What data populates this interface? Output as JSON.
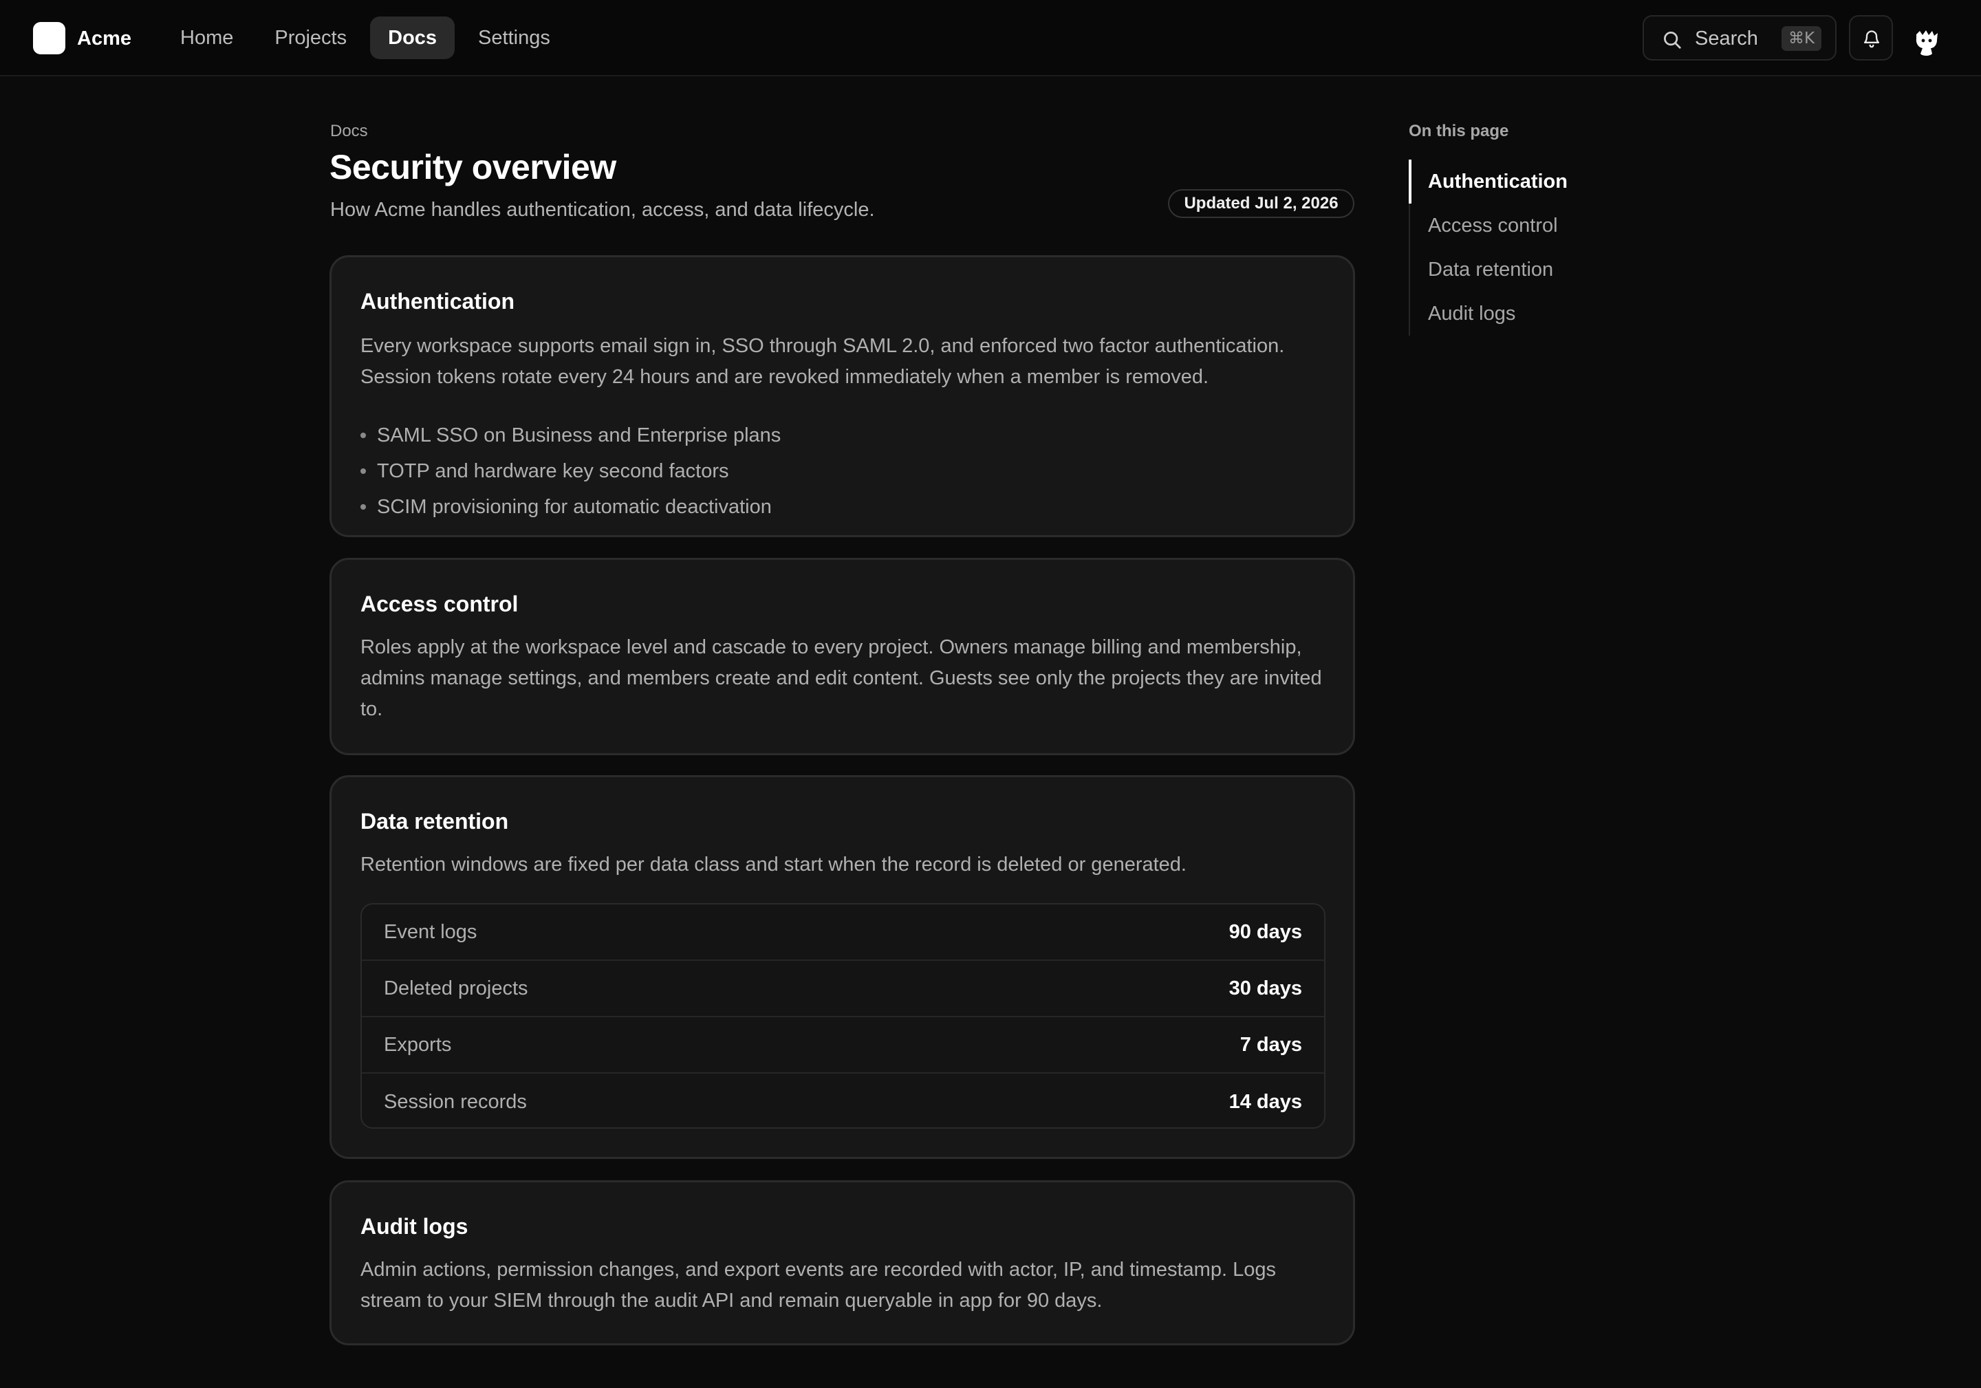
{
  "brand": {
    "name": "Acme"
  },
  "nav": {
    "items": [
      {
        "label": "Home",
        "active": false
      },
      {
        "label": "Projects",
        "active": false
      },
      {
        "label": "Docs",
        "active": true
      },
      {
        "label": "Settings",
        "active": false
      }
    ]
  },
  "search": {
    "label": "Search",
    "shortcut": "⌘K",
    "icon": "search-icon"
  },
  "notifications": {
    "icon": "bell-icon"
  },
  "page": {
    "breadcrumb": "Docs",
    "title": "Security overview",
    "subtitle": "How Acme handles authentication, access, and data lifecycle.",
    "updated": "Updated Jul 2, 2026"
  },
  "sections": {
    "authentication": {
      "title": "Authentication",
      "body": "Every workspace supports email sign in, SSO through SAML 2.0, and enforced two factor authentication. Session tokens rotate every 24 hours and are revoked immediately when a member is removed.",
      "bullets": [
        "SAML SSO on Business and Enterprise plans",
        "TOTP and hardware key second factors",
        "SCIM provisioning for automatic deactivation"
      ]
    },
    "access_control": {
      "title": "Access control",
      "body": "Roles apply at the workspace level and cascade to every project. Owners manage billing and membership, admins manage settings, and members create and edit content. Guests see only the projects they are invited to."
    },
    "data_retention": {
      "title": "Data retention",
      "body": "Retention windows are fixed per data class and start when the record is deleted or generated.",
      "rows": [
        {
          "label": "Event logs",
          "value": "90 days"
        },
        {
          "label": "Deleted projects",
          "value": "30 days"
        },
        {
          "label": "Exports",
          "value": "7 days"
        },
        {
          "label": "Session records",
          "value": "14 days"
        }
      ]
    },
    "audit_logs": {
      "title": "Audit logs",
      "body": "Admin actions, permission changes, and export events are recorded with actor, IP, and timestamp. Logs stream to your SIEM through the audit API and remain queryable in app for 90 days."
    }
  },
  "toc": {
    "heading": "On this page",
    "items": [
      {
        "label": "Authentication",
        "active": true
      },
      {
        "label": "Access control",
        "active": false
      },
      {
        "label": "Data retention",
        "active": false
      },
      {
        "label": "Audit logs",
        "active": false
      }
    ]
  },
  "colors": {
    "background": "#0b0b0b",
    "card": "#171717",
    "accent": "#ffffff"
  }
}
